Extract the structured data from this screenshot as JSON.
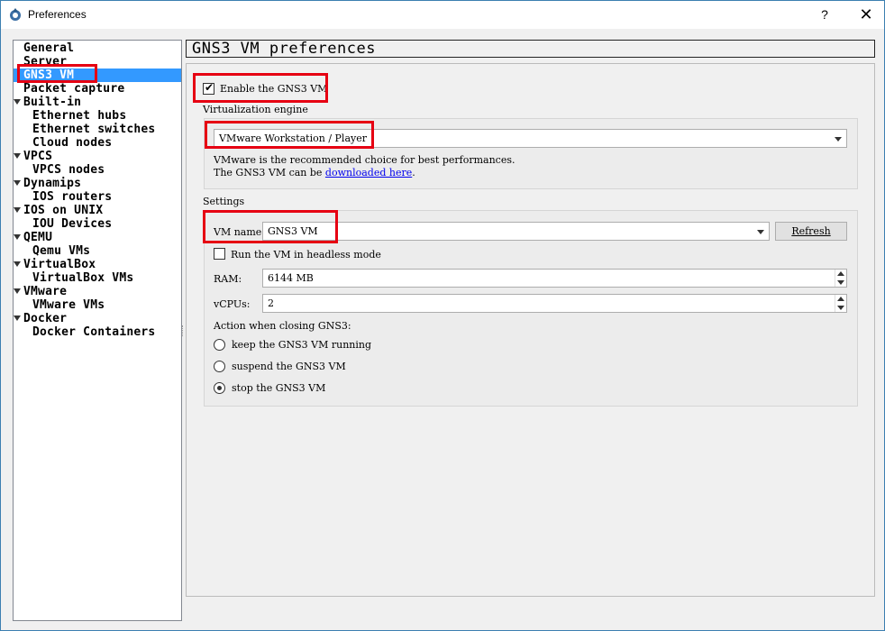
{
  "window": {
    "title": "Preferences",
    "help_label": "?",
    "close_label": "✕"
  },
  "tree": {
    "items": [
      {
        "label": "General",
        "level": 0,
        "expandable": false
      },
      {
        "label": "Server",
        "level": 0,
        "expandable": false
      },
      {
        "label": "GNS3 VM",
        "level": 0,
        "expandable": false,
        "selected": true
      },
      {
        "label": "Packet capture",
        "level": 0,
        "expandable": false
      },
      {
        "label": "Built-in",
        "level": 0,
        "expandable": true
      },
      {
        "label": "Ethernet hubs",
        "level": 1,
        "expandable": false
      },
      {
        "label": "Ethernet switches",
        "level": 1,
        "expandable": false
      },
      {
        "label": "Cloud nodes",
        "level": 1,
        "expandable": false
      },
      {
        "label": "VPCS",
        "level": 0,
        "expandable": true
      },
      {
        "label": "VPCS nodes",
        "level": 1,
        "expandable": false
      },
      {
        "label": "Dynamips",
        "level": 0,
        "expandable": true
      },
      {
        "label": "IOS routers",
        "level": 1,
        "expandable": false
      },
      {
        "label": "IOS on UNIX",
        "level": 0,
        "expandable": true
      },
      {
        "label": "IOU Devices",
        "level": 1,
        "expandable": false
      },
      {
        "label": "QEMU",
        "level": 0,
        "expandable": true
      },
      {
        "label": "Qemu VMs",
        "level": 1,
        "expandable": false
      },
      {
        "label": "VirtualBox",
        "level": 0,
        "expandable": true
      },
      {
        "label": "VirtualBox VMs",
        "level": 1,
        "expandable": false
      },
      {
        "label": "VMware",
        "level": 0,
        "expandable": true
      },
      {
        "label": "VMware VMs",
        "level": 1,
        "expandable": false
      },
      {
        "label": "Docker",
        "level": 0,
        "expandable": true
      },
      {
        "label": "Docker Containers",
        "level": 1,
        "expandable": false
      }
    ]
  },
  "panel": {
    "title": "GNS3 VM preferences",
    "enable_label": "Enable the GNS3 VM",
    "enable_checked": true,
    "virtualization_engine_label": "Virtualization engine",
    "engine_value": "VMware Workstation / Player",
    "engine_note_line1": "VMware is the recommended choice for best performances.",
    "engine_note_line2_prefix": "The GNS3 VM can be ",
    "engine_note_link": "downloaded here",
    "engine_note_line2_suffix": ".",
    "settings_label": "Settings",
    "vm_name_label": "VM name:",
    "vm_name_value": "GNS3 VM",
    "refresh_label": "Refresh",
    "headless_label": "Run the VM in headless mode",
    "headless_checked": false,
    "ram_label": "RAM:",
    "ram_value": "6144 MB",
    "vcpus_label": "vCPUs:",
    "vcpus_value": "2",
    "action_label": "Action when closing GNS3:",
    "action_options": [
      {
        "label": "keep the GNS3 VM running",
        "checked": false
      },
      {
        "label": "suspend the GNS3 VM",
        "checked": false
      },
      {
        "label": "stop the GNS3 VM",
        "checked": true
      }
    ]
  },
  "annotation_color": "#e60012",
  "selection_color": "#3399ff"
}
